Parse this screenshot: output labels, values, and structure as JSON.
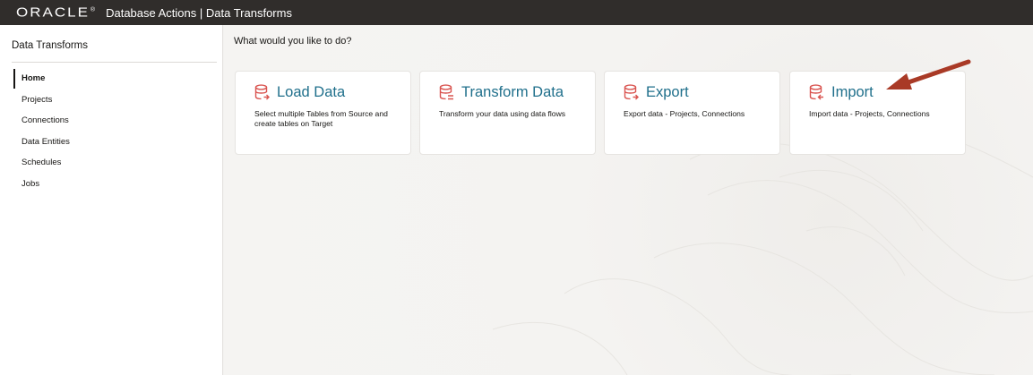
{
  "header": {
    "logo_text": "ORACLE",
    "logo_mark": "®",
    "title": "Database Actions | Data Transforms"
  },
  "sidebar": {
    "title": "Data Transforms",
    "items": [
      {
        "label": "Home",
        "active": true
      },
      {
        "label": "Projects",
        "active": false
      },
      {
        "label": "Connections",
        "active": false
      },
      {
        "label": "Data Entities",
        "active": false
      },
      {
        "label": "Schedules",
        "active": false
      },
      {
        "label": "Jobs",
        "active": false
      }
    ]
  },
  "main": {
    "prompt": "What would you like to do?",
    "cards": [
      {
        "title": "Load Data",
        "description": "Select multiple Tables from Source and create tables on Target",
        "icon": "database-load-icon"
      },
      {
        "title": "Transform Data",
        "description": "Transform your data using data flows",
        "icon": "database-transform-icon"
      },
      {
        "title": "Export",
        "description": "Export data - Projects, Connections",
        "icon": "database-export-icon"
      },
      {
        "title": "Import",
        "description": "Import data - Projects, Connections",
        "icon": "database-import-icon"
      }
    ]
  },
  "annotation": {
    "arrow_color": "#a93a26",
    "target": "Import"
  },
  "colors": {
    "header_bg": "#302d2b",
    "card_title": "#1f6f8b",
    "icon_red": "#d9534f"
  }
}
